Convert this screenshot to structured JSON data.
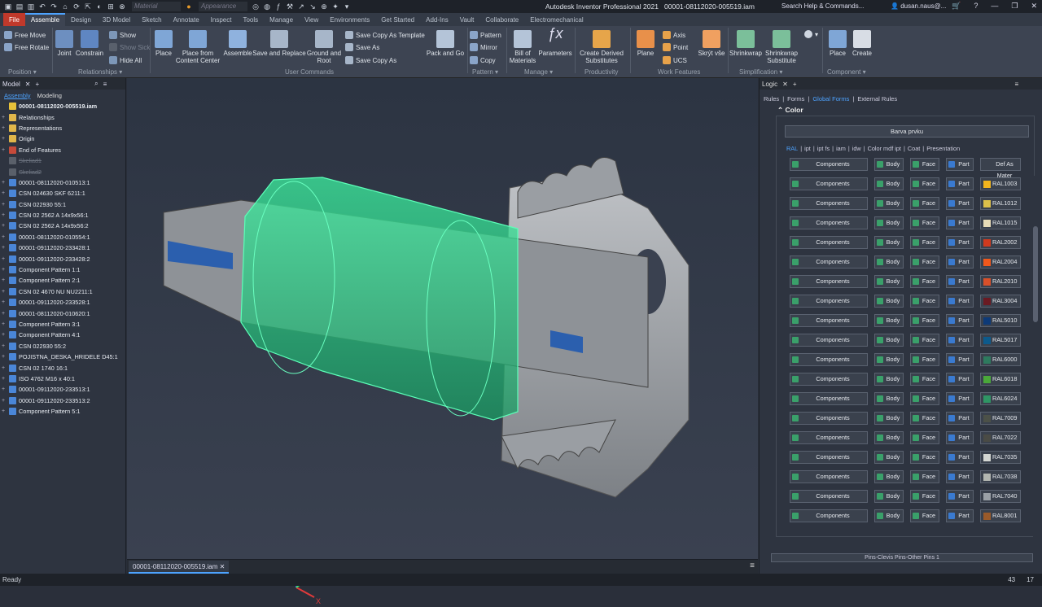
{
  "title": "Autodesk Inventor Professional 2021",
  "doc_name": "00001-08112020-005519.iam",
  "qat": {
    "material": "Material",
    "appearance": "Appearance"
  },
  "search": {
    "placeholder": "Search Help & Commands..."
  },
  "user": "dusan.naus@...",
  "tabs": [
    "File",
    "Assemble",
    "Design",
    "3D Model",
    "Sketch",
    "Annotate",
    "Inspect",
    "Tools",
    "Manage",
    "View",
    "Environments",
    "Get Started",
    "Add-Ins",
    "Vault",
    "Collaborate",
    "Electromechanical"
  ],
  "ribbon": {
    "free_move": "Free Move",
    "free_rotate": "Free Rotate",
    "joint": "Joint",
    "constrain": "Constrain",
    "show": "Show",
    "show_sick": "Show Sick",
    "hide_all": "Hide All",
    "place": "Place",
    "place_cc_1": "Place from",
    "place_cc_2": "Content Center",
    "assemble": "Assemble",
    "save_replace": "Save and Replace",
    "ground_root_1": "Ground and",
    "ground_root_2": "Root",
    "save_copy_template": "Save Copy As Template",
    "save_as": "Save As",
    "save_copy_as": "Save Copy As",
    "pack_go": "Pack and Go",
    "pattern": "Pattern",
    "mirror": "Mirror",
    "copy": "Copy",
    "bom_1": "Bill of",
    "bom_2": "Materials",
    "parameters": "Parameters",
    "derived_1": "Create Derived",
    "derived_2": "Substitutes",
    "plane": "Plane",
    "axis": "Axis",
    "point": "Point",
    "ucs": "UCS",
    "skryt": "Skrýt vše",
    "shrinkwrap": "Shrinkwrap",
    "shrinkwrap_sub_1": "Shrinkwrap",
    "shrinkwrap_sub_2": "Substitute",
    "place2": "Place",
    "create": "Create",
    "groups": {
      "position": "Position",
      "relationships": "Relationships",
      "user_commands": "User Commands",
      "pattern": "Pattern",
      "manage": "Manage",
      "productivity": "Productivity",
      "work_features": "Work Features",
      "simplification": "Simplification",
      "component": "Component"
    }
  },
  "left_panel": {
    "tab": "Model",
    "subtabs": [
      "Assembly",
      "Modeling"
    ],
    "tree": [
      {
        "label": "00001-08112020-005519.iam",
        "bold": true
      },
      {
        "label": "Relationships"
      },
      {
        "label": "Representations"
      },
      {
        "label": "Origin"
      },
      {
        "label": "End of Features"
      },
      {
        "label": "Skeliad1",
        "dim": true
      },
      {
        "label": "Skeliad2",
        "dim": true
      },
      {
        "label": "00001-08112020-010513:1"
      },
      {
        "label": "CSN 024630 SKF 6211:1"
      },
      {
        "label": "CSN 022930 55:1"
      },
      {
        "label": "CSN 02 2562 A 14x9x56:1"
      },
      {
        "label": "CSN 02 2562 A 14x9x56:2"
      },
      {
        "label": "00001-08112020-010554:1"
      },
      {
        "label": "00001-09112020-233428:1"
      },
      {
        "label": "00001-09112020-233428:2"
      },
      {
        "label": "Component Pattern 1:1"
      },
      {
        "label": "Component Pattern 2:1"
      },
      {
        "label": "CSN 02 4670 NU NU2211:1"
      },
      {
        "label": "00001-09112020-233528:1"
      },
      {
        "label": "00001-08112020-010620:1"
      },
      {
        "label": "Component Pattern 3:1"
      },
      {
        "label": "Component Pattern 4:1"
      },
      {
        "label": "CSN 022930 55:2"
      },
      {
        "label": "POJISTNA_DESKA_HRIDELE D45:1"
      },
      {
        "label": "CSN 02 1740 16:1"
      },
      {
        "label": "ISO 4762 M16 x 40:1"
      },
      {
        "label": "00001-09112020-233513:1"
      },
      {
        "label": "00001-09112020-233513:2"
      },
      {
        "label": "Component Pattern 5:1"
      }
    ]
  },
  "right_panel": {
    "tab": "Logic",
    "links": [
      "Rules",
      "Forms",
      "Global Forms",
      "External Rules"
    ],
    "section": "Color",
    "barva": "Barva prvku",
    "subtabs": [
      "RAL",
      "ipt",
      "ipt fs",
      "iam",
      "idw",
      "Color mdf ipt",
      "Coat",
      "Presentation"
    ],
    "btn_components": "Components",
    "btn_body": "Body",
    "btn_face": "Face",
    "btn_part": "Part",
    "rows": [
      {
        "ral": "Def As Mater",
        "color": ""
      },
      {
        "ral": "RAL1003",
        "color": "#f2b51e"
      },
      {
        "ral": "RAL1012",
        "color": "#dcc04a"
      },
      {
        "ral": "RAL1015",
        "color": "#e8dcb8"
      },
      {
        "ral": "RAL2002",
        "color": "#cf3a1f"
      },
      {
        "ral": "RAL2004",
        "color": "#f0581c"
      },
      {
        "ral": "RAL2010",
        "color": "#d8502a"
      },
      {
        "ral": "RAL3004",
        "color": "#6a1a22"
      },
      {
        "ral": "RAL5010",
        "color": "#0d3a78"
      },
      {
        "ral": "RAL5017",
        "color": "#0d5a8c"
      },
      {
        "ral": "RAL6000",
        "color": "#2e7a5e"
      },
      {
        "ral": "RAL6018",
        "color": "#4aa83a"
      },
      {
        "ral": "RAL6024",
        "color": "#2f9564"
      },
      {
        "ral": "RAL7009",
        "color": "#4c5148"
      },
      {
        "ral": "RAL7022",
        "color": "#4a4b45"
      },
      {
        "ral": "RAL7035",
        "color": "#d3d6d2"
      },
      {
        "ral": "RAL7038",
        "color": "#b2b6b0"
      },
      {
        "ral": "RAL7040",
        "color": "#9aa0a6"
      },
      {
        "ral": "RAL8001",
        "color": "#9a5a2a"
      }
    ],
    "footer": "Pins-Clevis Pins-Other Pins 1"
  },
  "status": {
    "text": "Ready",
    "num1": "43",
    "num2": "17"
  },
  "colors": {
    "accent": "#4da3ff",
    "file_tab": "#c0392b",
    "model_green": "#2fdc8a"
  }
}
